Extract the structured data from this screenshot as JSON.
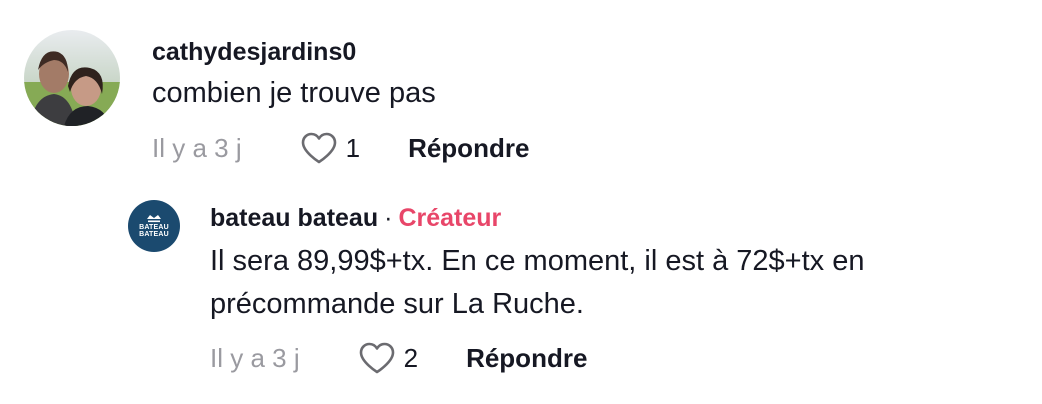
{
  "comments": [
    {
      "username": "cathydesjardins0",
      "text": "combien je trouve pas",
      "time": "Il y a 3 j",
      "likes": "1",
      "reply_label": "Répondre"
    },
    {
      "username": "bateau bateau",
      "separator": "·",
      "badge": "Créateur",
      "text_line1": "Il sera 89,99$+tx. En ce moment, il est à 72$+tx en",
      "text_line2": "précommande sur La Ruche.",
      "time": "Il y a 3 j",
      "likes": "2",
      "reply_label": "Répondre",
      "avatar_logo": [
        "BATEAU",
        "BATEAU"
      ]
    }
  ],
  "colors": {
    "text": "#161823",
    "muted": "#9a9aa0",
    "creator_badge": "#e84669",
    "brand_avatar": "#1b4a6f"
  },
  "icons": {
    "like": "heart-outline-icon",
    "brand": "boat-icon"
  }
}
